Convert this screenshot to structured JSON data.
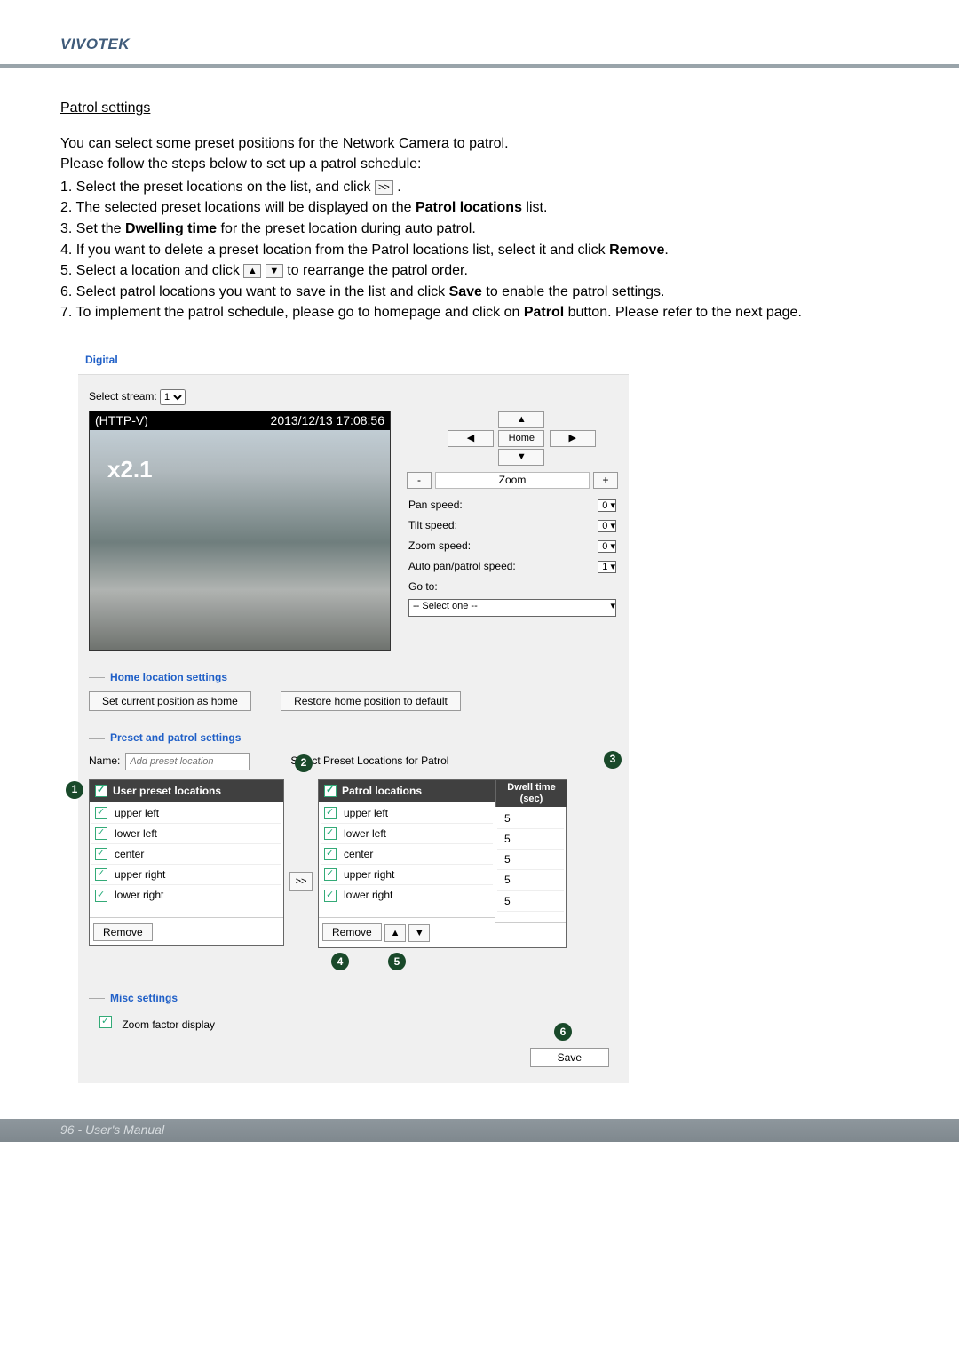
{
  "brand": "VIVOTEK",
  "section_title": "Patrol settings",
  "intro1": "You can select some preset positions for the Network Camera to patrol.",
  "intro2": "Please follow the steps below to set up a patrol schedule:",
  "steps": [
    "1. Select the preset locations on the list, and click ",
    "2. The selected preset locations will be displayed on the Patrol locations list.",
    "3. Set the Dwelling time for the preset location during auto patrol.",
    "4. If you want to delete a preset location from the Patrol locations list, select it and click Remove.",
    "5. Select a location and click  to rearrange the patrol order.",
    "6. Select patrol locations you want to save in the list and click Save to enable the patrol settings.",
    "7. To implement the patrol schedule, please go to homepage and click on Patrol button. Please refer to the next page."
  ],
  "step1_btn": ">>",
  "step5_btn_up": "▲",
  "step5_btn_down": "▼",
  "embedded": {
    "digital": "Digital",
    "select_stream_label": "Select stream:",
    "select_stream_value": "1",
    "overlay_left": "(HTTP-V)",
    "overlay_right": "2013/12/13  17:08:56",
    "zoom_text": "x2.1",
    "ptz": {
      "up": "▲",
      "down": "▼",
      "left": "◀",
      "right": "▶",
      "home": "Home"
    },
    "zoom": {
      "minus": "-",
      "label": "Zoom",
      "plus": "+"
    },
    "speeds": {
      "pan_label": "Pan speed:",
      "pan_value": "0",
      "tilt_label": "Tilt speed:",
      "tilt_value": "0",
      "zoom_label": "Zoom speed:",
      "zoom_value": "0",
      "auto_label": "Auto pan/patrol speed:",
      "auto_value": "1"
    },
    "goto_label": "Go to:",
    "goto_value": "-- Select one --",
    "home_legend": "Home location settings",
    "home_btn1": "Set current position as home",
    "home_btn2": "Restore home position to default",
    "pp_legend": "Preset and patrol settings",
    "name_label": "Name:",
    "name_placeholder": "Add preset location",
    "select_patrol_label": "Select Preset Locations for Patrol",
    "user_preset_header": "User preset locations",
    "preset_items": [
      "upper left",
      "lower left",
      "center",
      "upper right",
      "lower right"
    ],
    "preset_remove": "Remove",
    "transfer": ">>",
    "patrol_header": "Patrol locations",
    "dwell_header": "Dwell time (sec)",
    "patrol_items": [
      {
        "name": "upper left",
        "dwell": "5"
      },
      {
        "name": "lower left",
        "dwell": "5"
      },
      {
        "name": "center",
        "dwell": "5"
      },
      {
        "name": "upper right",
        "dwell": "5"
      },
      {
        "name": "lower right",
        "dwell": "5"
      }
    ],
    "patrol_remove": "Remove",
    "patrol_up": "▲",
    "patrol_down": "▼",
    "misc_legend": "Misc settings",
    "misc_zoom_factor": "Zoom factor display",
    "save": "Save"
  },
  "callouts": {
    "1": "1",
    "2": "2",
    "3": "3",
    "4": "4",
    "5": "5",
    "6": "6"
  },
  "footer": "96 - User's Manual"
}
